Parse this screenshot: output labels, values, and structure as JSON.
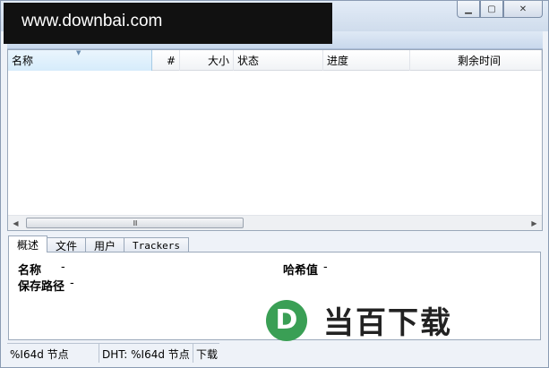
{
  "watermark": {
    "text": "www.downbai.com"
  },
  "window_controls": {
    "minimize_icon": "minimize-icon",
    "maximize_icon": "maximize-icon",
    "close_icon": "close-icon"
  },
  "list": {
    "columns": [
      {
        "key": "name",
        "label": "名称"
      },
      {
        "key": "hash",
        "label": "#"
      },
      {
        "key": "size",
        "label": "大小"
      },
      {
        "key": "status",
        "label": "状态"
      },
      {
        "key": "progress",
        "label": "进度"
      },
      {
        "key": "eta",
        "label": "剩余时间"
      }
    ],
    "scroll_thumb_grip": "Ⅲ"
  },
  "tabs": [
    {
      "label": "概述",
      "active": true
    },
    {
      "label": "文件",
      "active": false
    },
    {
      "label": "用户",
      "active": false
    },
    {
      "label": "Trackers",
      "active": false
    }
  ],
  "details": {
    "name_label": "名称",
    "name_value": "-",
    "hash_label": "哈希值",
    "hash_value": "-",
    "path_label": "保存路径",
    "path_value": "-"
  },
  "logo": {
    "mark": "D",
    "text": "当百下载",
    "color": "#3a9f55"
  },
  "statusbar": {
    "nodes": "%I64d 节点",
    "dht": "DHT: %I64d 节点",
    "download": "下载"
  }
}
